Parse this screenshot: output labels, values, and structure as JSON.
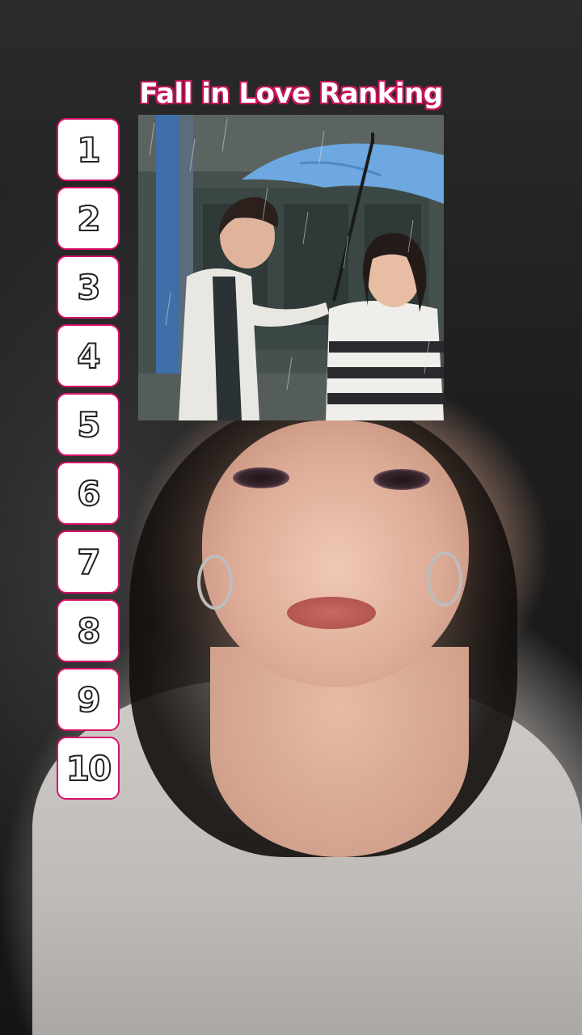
{
  "overlay": {
    "title": "Fall in Love Ranking",
    "title_color": "#ffffff",
    "title_outline_color": "#c4145a",
    "slot_border_color": "#d8116a"
  },
  "ranking": {
    "slots": [
      {
        "number": "1"
      },
      {
        "number": "2"
      },
      {
        "number": "3"
      },
      {
        "number": "4"
      },
      {
        "number": "5"
      },
      {
        "number": "6"
      },
      {
        "number": "7"
      },
      {
        "number": "8"
      },
      {
        "number": "9"
      },
      {
        "number": "10"
      }
    ]
  },
  "photo_card": {
    "subject": "couple-under-blue-umbrella-in-rain",
    "umbrella_color": "#6ea8e0"
  }
}
